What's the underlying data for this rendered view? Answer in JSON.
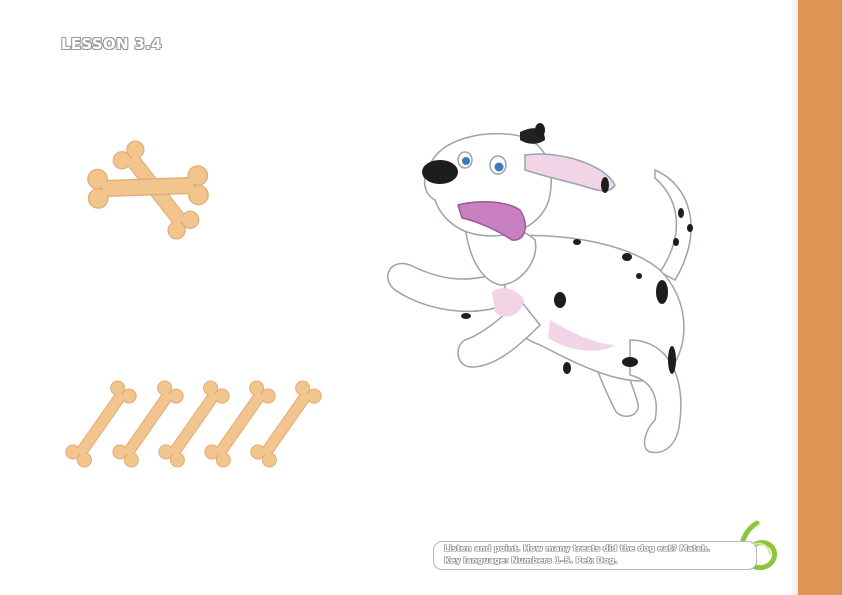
{
  "lesson": {
    "label": "LESSON 3.4"
  },
  "illustrations": {
    "top_group": {
      "bone_count": 2,
      "icon": "bone-icon"
    },
    "bottom_group": {
      "bone_count": 5,
      "icon": "bone-icon"
    },
    "dog": {
      "icon": "dalmatian-dog-illustration"
    },
    "logo": {
      "icon": "green-swirl-logo"
    }
  },
  "instructions": {
    "line1": "Listen and point. How many treats did the dog eat? Match.",
    "line2": "Key language: Numbers 1–5. Pet: Dog."
  },
  "colors": {
    "sidebar": "#dc9552",
    "bone": "#f2c48e",
    "bone_shadow": "#dba770",
    "logo": "#8cc63f"
  }
}
